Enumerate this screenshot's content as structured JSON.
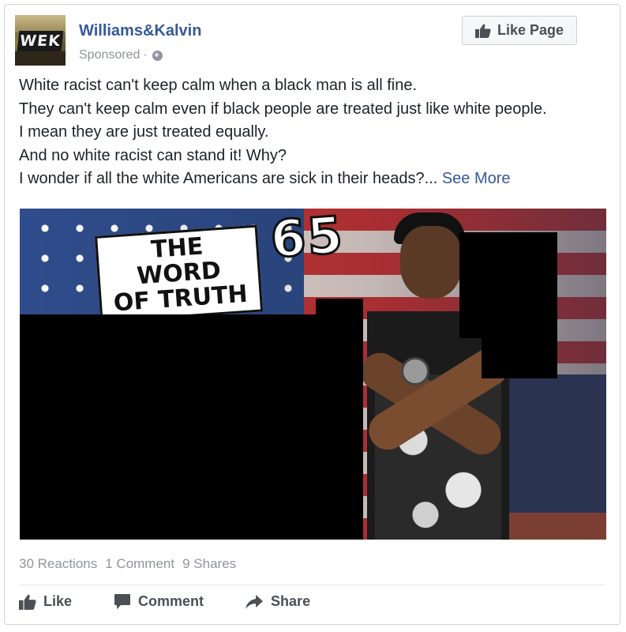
{
  "post": {
    "page_name": "Williams&Kalvin",
    "logo_text": "WEK",
    "sponsored_label": "Sponsored",
    "sponsored_separator": "·",
    "audience_icon": "globe-icon",
    "like_page_label": "Like Page",
    "text_lines": [
      "White racist can't keep calm when a black man is all fine.",
      "They can't keep calm even if black people are treated just like white people.",
      "I mean they are just treated equally.",
      "And no white racist can stand it! Why?",
      "I wonder if all the white Americans are sick in their heads?..."
    ],
    "see_more_label": "See More",
    "image": {
      "headline_line1": "THE WORD",
      "headline_line2": "OF TRUTH",
      "headline_number": "65"
    }
  },
  "stats": {
    "reactions": "30 Reactions",
    "comments": "1 Comment",
    "shares": "9 Shares"
  },
  "actions": {
    "like_label": "Like",
    "comment_label": "Comment",
    "share_label": "Share"
  },
  "colors": {
    "link": "#365899",
    "text": "#1d2129",
    "muted": "#90949c",
    "action_text": "#4b4f56",
    "border": "#cfd3da"
  }
}
